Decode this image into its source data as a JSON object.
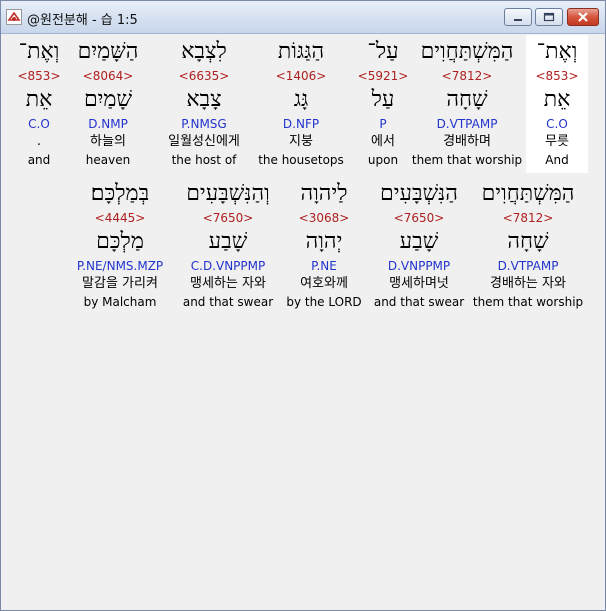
{
  "window": {
    "title": "@원전분해 - 습 1:5"
  },
  "rows": [
    [
      {
        "heb": "וְאֶת־",
        "num": "<853>",
        "lemma": "אֵת",
        "code": "C.O",
        "kor": "무릇",
        "eng": "And",
        "selected": true
      },
      {
        "heb": "הַמִּשְׁתַּחֲוִים",
        "num": "<7812>",
        "lemma": "שָׁחָה",
        "code": "D.VTPAMP",
        "kor": "경배하며",
        "eng": "them that worship"
      },
      {
        "heb": "עַל־",
        "num": "<5921>",
        "lemma": "עַל",
        "code": "P",
        "kor": "에서",
        "eng": "upon"
      },
      {
        "heb": "הַגַּגּוֹת",
        "num": "<1406>",
        "lemma": "גָּג",
        "code": "D.NFP",
        "kor": "지붕",
        "eng": "the housetops"
      },
      {
        "heb": "לִצְבָא",
        "num": "<6635>",
        "lemma": "צָבָא",
        "code": "P.NMSG",
        "kor": "일월성신에게",
        "eng": "the host of"
      },
      {
        "heb": "הַשָּׁמַיִם",
        "num": "<8064>",
        "lemma": "שָׁמַיִם",
        "code": "D.NMP",
        "kor": "하늘의",
        "eng": "heaven"
      },
      {
        "heb": "וְאֶת־",
        "num": "<853>",
        "lemma": "אֵת",
        "code": "C.O",
        "kor": ".",
        "eng": "and"
      }
    ],
    [
      {
        "heb": "הַמִּשְׁתַּחֲוִים",
        "num": "<7812>",
        "lemma": "שָׁחָה",
        "code": "D.VTPAMP",
        "kor": "경배하는 자와",
        "eng": "them that worship"
      },
      {
        "heb": "הַנִּשְׁבָּעִים",
        "num": "<7650>",
        "lemma": "שָׁבַע",
        "code": "D.VNPPMP",
        "kor": "맹세하며넛",
        "eng": "and that swear"
      },
      {
        "heb": "לַיהוָה",
        "num": "<3068>",
        "lemma": "יְהוָה",
        "code": "P.NE",
        "kor": "여호와께",
        "eng": "by the LORD"
      },
      {
        "heb": "וְהַנִּשְׁבָּעִים",
        "num": "<7650>",
        "lemma": "שָׁבַע",
        "code": "C.D.VNPPMP",
        "kor": "맹세하는 자와",
        "eng": "and that swear"
      },
      {
        "heb": "בְּמַלְכָּם׃",
        "num": "<4445>",
        "lemma": "מַלְכָּם",
        "code": "P.NE/NMS.MZP",
        "kor": "말감을 가리켜",
        "eng": "by Malcham"
      }
    ]
  ]
}
